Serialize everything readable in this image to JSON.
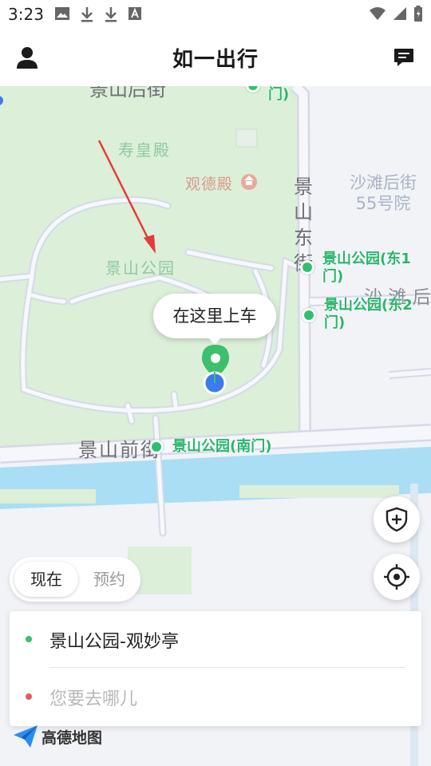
{
  "status_bar": {
    "time": "3:23",
    "left_icons": [
      "image-icon",
      "download-icon",
      "download-icon",
      "a-icon"
    ],
    "right_icons": [
      "wifi-icon",
      "signal-icon",
      "battery-icon"
    ]
  },
  "header": {
    "title": "如一出行",
    "profile_icon": "person-icon",
    "message_icon": "message-icon"
  },
  "map": {
    "labels": {
      "top_road": "景山后街",
      "shouhuang": "寿皇殿",
      "guande": "观德殿",
      "park": "景山公园",
      "east_street": "景山东街",
      "shatan": "沙滩后街\n55号院",
      "shatan2": "沙 滩 后",
      "front_street": "景山前街"
    },
    "pois": {
      "east1": "景山公园(东1\n门)",
      "east2": "景山公园(东2\n门)",
      "south": "景山公园(南门)",
      "top_partial": "门)"
    },
    "pickup_bubble": "在这里上车",
    "colors": {
      "park": "#dcefd9",
      "water": "#a9def5",
      "road": "#ffffff",
      "poi": "#2ab56b",
      "pin": "#3dbf6e",
      "location": "#3a7bf0",
      "arrow": "#e33c3c"
    }
  },
  "controls": {
    "safety_icon": "shield-plus-icon",
    "locate_icon": "crosshair-icon"
  },
  "mode_toggle": {
    "now": "现在",
    "reserve": "预约"
  },
  "trip": {
    "origin": "景山公园-观妙亭",
    "destination_placeholder": "您要去哪儿",
    "origin_color": "#39c26f",
    "destination_color": "#e45a61"
  },
  "brand": {
    "name": "高德地图"
  }
}
